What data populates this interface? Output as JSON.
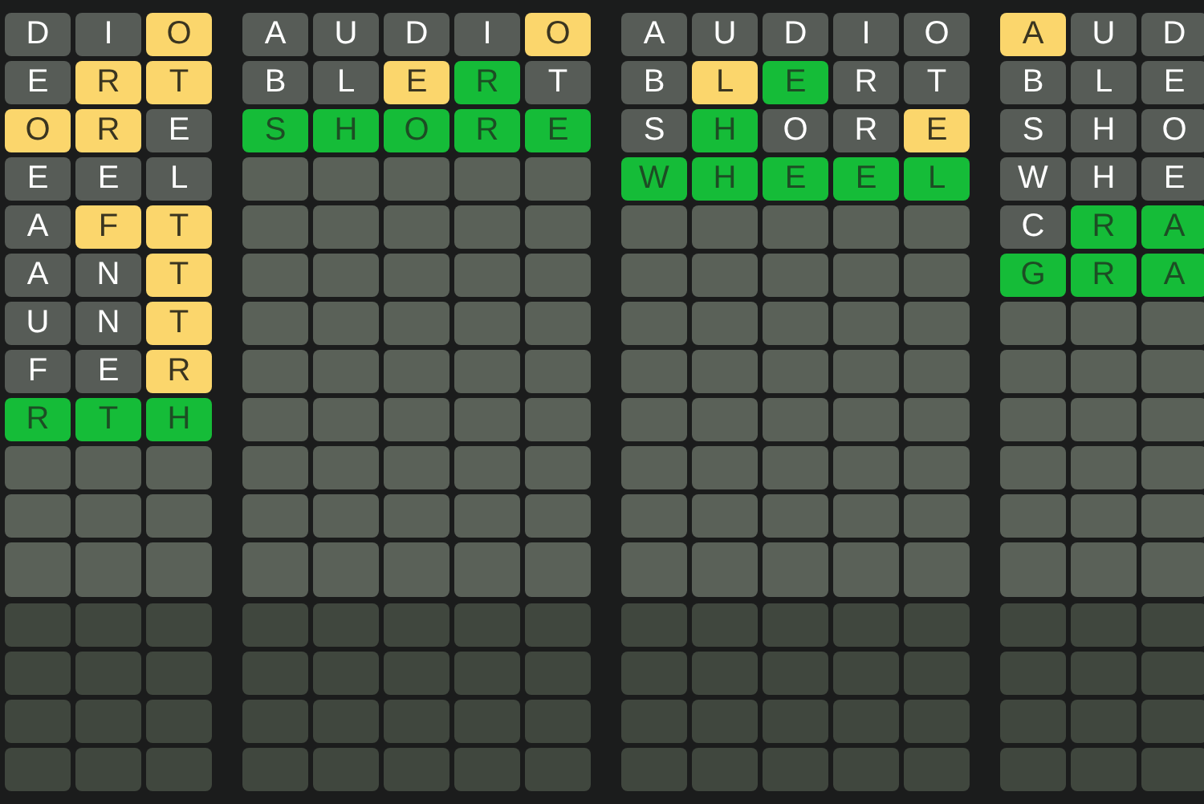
{
  "boards": [
    {
      "rows": [
        {
          "kind": "guess",
          "tiles": [
            {
              "letter": "D",
              "kind": "absent"
            },
            {
              "letter": "I",
              "kind": "absent"
            },
            {
              "letter": "O",
              "kind": "present"
            }
          ]
        },
        {
          "kind": "guess",
          "tiles": [
            {
              "letter": "E",
              "kind": "absent"
            },
            {
              "letter": "R",
              "kind": "present"
            },
            {
              "letter": "T",
              "kind": "present"
            }
          ]
        },
        {
          "kind": "guess",
          "tiles": [
            {
              "letter": "O",
              "kind": "present"
            },
            {
              "letter": "R",
              "kind": "present"
            },
            {
              "letter": "E",
              "kind": "absent"
            }
          ]
        },
        {
          "kind": "guess",
          "tiles": [
            {
              "letter": "E",
              "kind": "absent"
            },
            {
              "letter": "E",
              "kind": "absent"
            },
            {
              "letter": "L",
              "kind": "absent"
            }
          ]
        },
        {
          "kind": "guess",
          "tiles": [
            {
              "letter": "A",
              "kind": "absent"
            },
            {
              "letter": "F",
              "kind": "present"
            },
            {
              "letter": "T",
              "kind": "present"
            }
          ]
        },
        {
          "kind": "guess",
          "tiles": [
            {
              "letter": "A",
              "kind": "absent"
            },
            {
              "letter": "N",
              "kind": "absent"
            },
            {
              "letter": "T",
              "kind": "present"
            }
          ]
        },
        {
          "kind": "guess",
          "tiles": [
            {
              "letter": "U",
              "kind": "absent"
            },
            {
              "letter": "N",
              "kind": "absent"
            },
            {
              "letter": "T",
              "kind": "present"
            }
          ]
        },
        {
          "kind": "guess",
          "tiles": [
            {
              "letter": "F",
              "kind": "absent"
            },
            {
              "letter": "E",
              "kind": "absent"
            },
            {
              "letter": "R",
              "kind": "present"
            }
          ]
        },
        {
          "kind": "guess",
          "tiles": [
            {
              "letter": "R",
              "kind": "correct"
            },
            {
              "letter": "T",
              "kind": "correct"
            },
            {
              "letter": "H",
              "kind": "correct"
            }
          ]
        },
        {
          "kind": "blank"
        },
        {
          "kind": "blank"
        },
        {
          "kind": "blank"
        },
        {
          "kind": "dim"
        },
        {
          "kind": "dim"
        },
        {
          "kind": "dim"
        },
        {
          "kind": "dim"
        }
      ]
    },
    {
      "rows": [
        {
          "kind": "guess",
          "tiles": [
            {
              "letter": "A",
              "kind": "absent"
            },
            {
              "letter": "U",
              "kind": "absent"
            },
            {
              "letter": "D",
              "kind": "absent"
            },
            {
              "letter": "I",
              "kind": "absent"
            },
            {
              "letter": "O",
              "kind": "present"
            }
          ]
        },
        {
          "kind": "guess",
          "tiles": [
            {
              "letter": "B",
              "kind": "absent"
            },
            {
              "letter": "L",
              "kind": "absent"
            },
            {
              "letter": "E",
              "kind": "present"
            },
            {
              "letter": "R",
              "kind": "correct"
            },
            {
              "letter": "T",
              "kind": "absent"
            }
          ]
        },
        {
          "kind": "guess",
          "tiles": [
            {
              "letter": "S",
              "kind": "correct"
            },
            {
              "letter": "H",
              "kind": "correct"
            },
            {
              "letter": "O",
              "kind": "correct"
            },
            {
              "letter": "R",
              "kind": "correct"
            },
            {
              "letter": "E",
              "kind": "correct"
            }
          ]
        },
        {
          "kind": "blank"
        },
        {
          "kind": "blank"
        },
        {
          "kind": "blank"
        },
        {
          "kind": "blank"
        },
        {
          "kind": "blank"
        },
        {
          "kind": "blank"
        },
        {
          "kind": "blank"
        },
        {
          "kind": "blank"
        },
        {
          "kind": "blank"
        },
        {
          "kind": "dim"
        },
        {
          "kind": "dim"
        },
        {
          "kind": "dim"
        },
        {
          "kind": "dim"
        }
      ]
    },
    {
      "rows": [
        {
          "kind": "guess",
          "tiles": [
            {
              "letter": "A",
              "kind": "absent"
            },
            {
              "letter": "U",
              "kind": "absent"
            },
            {
              "letter": "D",
              "kind": "absent"
            },
            {
              "letter": "I",
              "kind": "absent"
            },
            {
              "letter": "O",
              "kind": "absent"
            }
          ]
        },
        {
          "kind": "guess",
          "tiles": [
            {
              "letter": "B",
              "kind": "absent"
            },
            {
              "letter": "L",
              "kind": "present"
            },
            {
              "letter": "E",
              "kind": "correct"
            },
            {
              "letter": "R",
              "kind": "absent"
            },
            {
              "letter": "T",
              "kind": "absent"
            }
          ]
        },
        {
          "kind": "guess",
          "tiles": [
            {
              "letter": "S",
              "kind": "absent"
            },
            {
              "letter": "H",
              "kind": "correct"
            },
            {
              "letter": "O",
              "kind": "absent"
            },
            {
              "letter": "R",
              "kind": "absent"
            },
            {
              "letter": "E",
              "kind": "present"
            }
          ]
        },
        {
          "kind": "guess",
          "tiles": [
            {
              "letter": "W",
              "kind": "correct"
            },
            {
              "letter": "H",
              "kind": "correct"
            },
            {
              "letter": "E",
              "kind": "correct"
            },
            {
              "letter": "E",
              "kind": "correct"
            },
            {
              "letter": "L",
              "kind": "correct"
            }
          ]
        },
        {
          "kind": "blank"
        },
        {
          "kind": "blank"
        },
        {
          "kind": "blank"
        },
        {
          "kind": "blank"
        },
        {
          "kind": "blank"
        },
        {
          "kind": "blank"
        },
        {
          "kind": "blank"
        },
        {
          "kind": "blank"
        },
        {
          "kind": "dim"
        },
        {
          "kind": "dim"
        },
        {
          "kind": "dim"
        },
        {
          "kind": "dim"
        }
      ]
    },
    {
      "rows": [
        {
          "kind": "guess",
          "tiles": [
            {
              "letter": "A",
              "kind": "present"
            },
            {
              "letter": "U",
              "kind": "absent"
            },
            {
              "letter": "D",
              "kind": "absent"
            }
          ]
        },
        {
          "kind": "guess",
          "tiles": [
            {
              "letter": "B",
              "kind": "absent"
            },
            {
              "letter": "L",
              "kind": "absent"
            },
            {
              "letter": "E",
              "kind": "absent"
            }
          ]
        },
        {
          "kind": "guess",
          "tiles": [
            {
              "letter": "S",
              "kind": "absent"
            },
            {
              "letter": "H",
              "kind": "absent"
            },
            {
              "letter": "O",
              "kind": "absent"
            }
          ]
        },
        {
          "kind": "guess",
          "tiles": [
            {
              "letter": "W",
              "kind": "absent"
            },
            {
              "letter": "H",
              "kind": "absent"
            },
            {
              "letter": "E",
              "kind": "absent"
            }
          ]
        },
        {
          "kind": "guess",
          "tiles": [
            {
              "letter": "C",
              "kind": "absent"
            },
            {
              "letter": "R",
              "kind": "correct"
            },
            {
              "letter": "A",
              "kind": "correct"
            }
          ]
        },
        {
          "kind": "guess",
          "tiles": [
            {
              "letter": "G",
              "kind": "correct"
            },
            {
              "letter": "R",
              "kind": "correct"
            },
            {
              "letter": "A",
              "kind": "correct"
            }
          ]
        },
        {
          "kind": "blank"
        },
        {
          "kind": "blank"
        },
        {
          "kind": "blank"
        },
        {
          "kind": "blank"
        },
        {
          "kind": "blank"
        },
        {
          "kind": "blank"
        },
        {
          "kind": "dim"
        },
        {
          "kind": "dim"
        },
        {
          "kind": "dim"
        },
        {
          "kind": "dim"
        }
      ]
    }
  ]
}
